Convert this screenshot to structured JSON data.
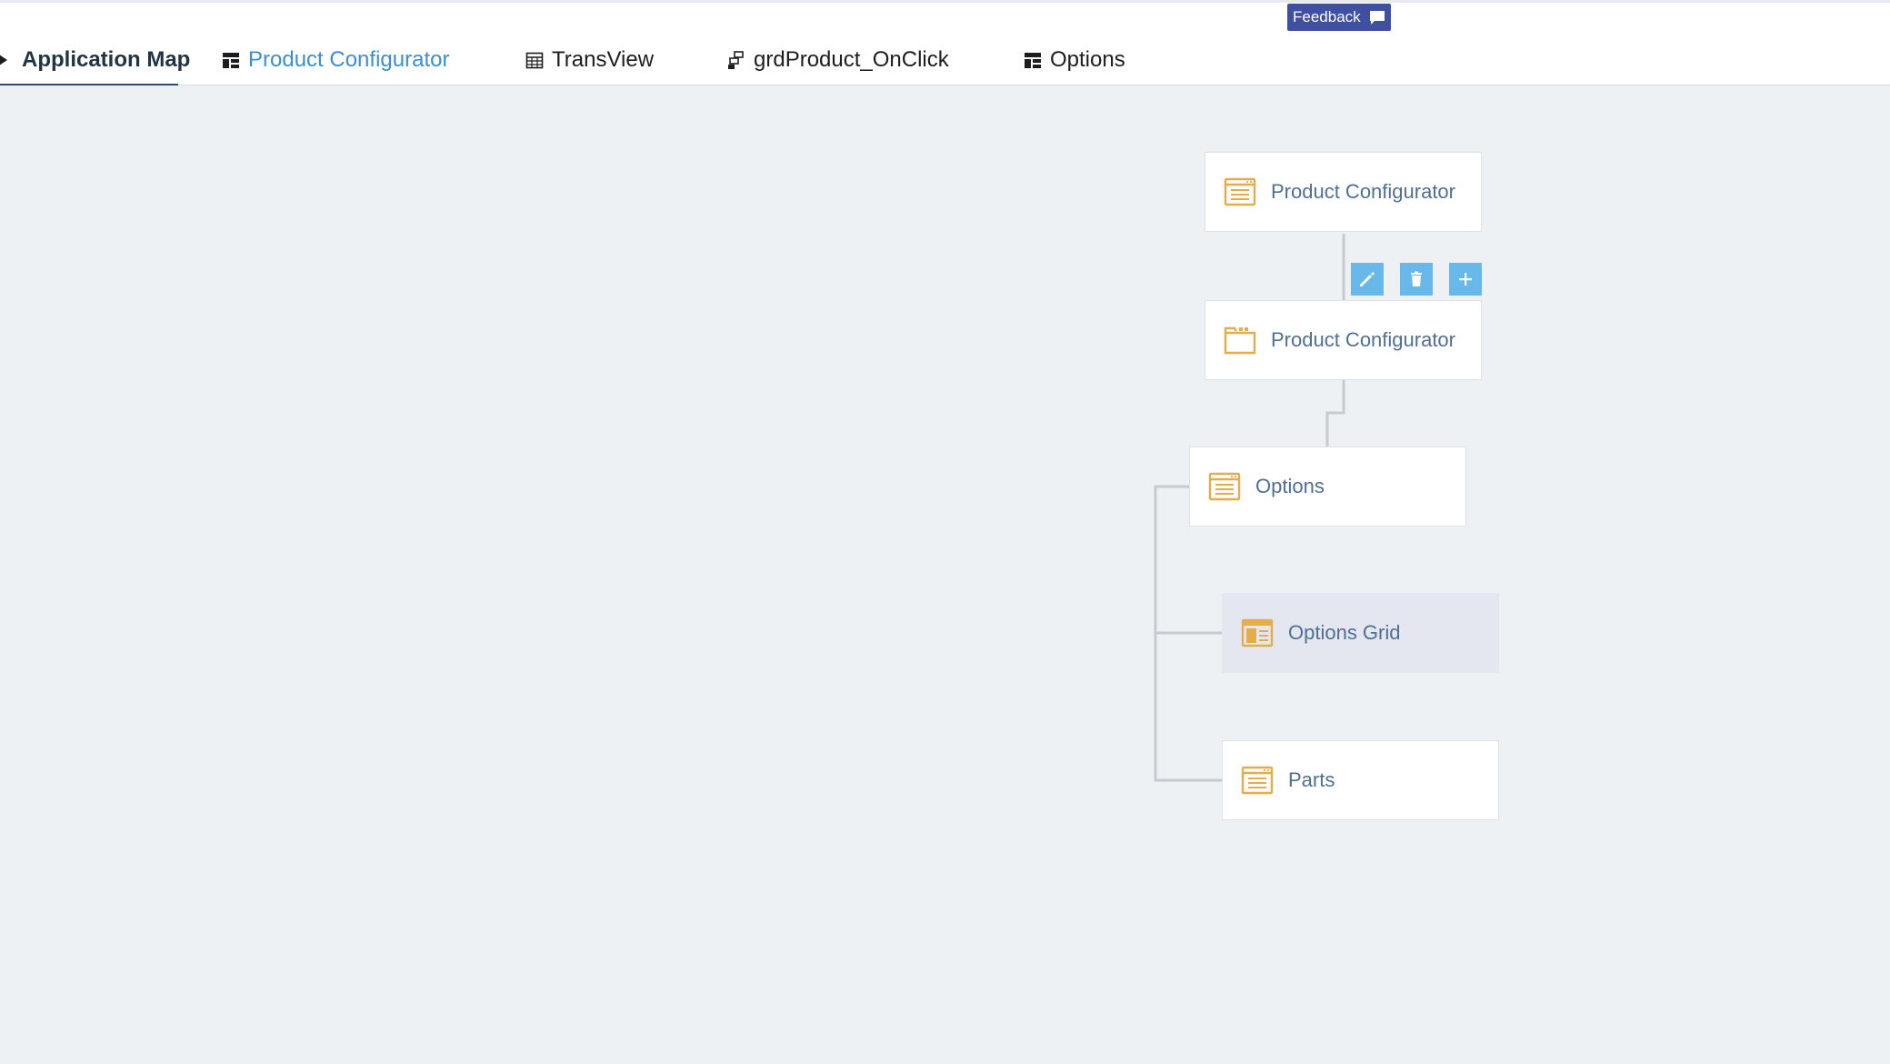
{
  "tabs": [
    {
      "label": "Application Map",
      "icon": "pencil-arrow-icon",
      "state": "active"
    },
    {
      "label": "Product Configurator",
      "icon": "layout-icon",
      "state": "hover"
    },
    {
      "label": "TransView",
      "icon": "table-icon",
      "state": "normal"
    },
    {
      "label": "grdProduct_OnClick",
      "icon": "event-icon",
      "state": "normal"
    },
    {
      "label": "Options",
      "icon": "layout-icon",
      "state": "normal"
    }
  ],
  "feedback": {
    "label": "Feedback",
    "icon": "comment-icon",
    "color": "#3f4fa1"
  },
  "tree": {
    "nodes": [
      {
        "label": "Product Configurator",
        "icon": "form-icon"
      },
      {
        "label": "Product Configurator",
        "icon": "folder-icon"
      },
      {
        "label": "Options",
        "icon": "form-icon"
      },
      {
        "label": "Options Grid",
        "icon": "grid-form-icon",
        "selected": true
      },
      {
        "label": "Parts",
        "icon": "form-icon"
      }
    ],
    "actions": [
      {
        "icon": "pencil-icon"
      },
      {
        "icon": "trash-icon"
      },
      {
        "icon": "plus-icon"
      }
    ]
  },
  "colors": {
    "accent": "#2f4b6a",
    "link_hover": "#3b8fd0",
    "node_text": "#4f6f95",
    "node_icon": "#e4ad4a",
    "action_bg": "#69b8ea",
    "canvas_bg": "#eef1f4",
    "selected_bg": "#e4e6f0"
  }
}
